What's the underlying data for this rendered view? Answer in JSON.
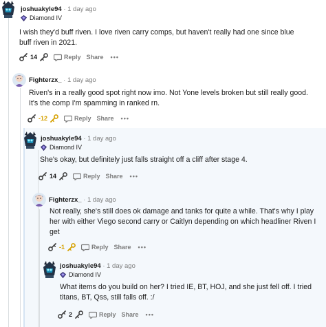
{
  "comments": [
    {
      "username": "joshuakyle94",
      "separator": "·",
      "time": "1 day ago",
      "flair": "Diamond IV",
      "body": "I wish they'd buff riven. I love riven carry comps, but haven't really had one since blue buff riven in 2021.",
      "votes": "14",
      "reply_label": "Reply",
      "share_label": "Share",
      "more_label": "•••"
    },
    {
      "username": "Fighterzx_",
      "separator": "·",
      "time": "1 day ago",
      "body": "Riven's in a really good spot right now imo. Not Yone levels broken but still really good. It's the comp I'm spamming in ranked rn.",
      "votes": "-12",
      "reply_label": "Reply",
      "share_label": "Share",
      "more_label": "•••"
    },
    {
      "username": "joshuakyle94",
      "separator": "·",
      "time": "1 day ago",
      "flair": "Diamond IV",
      "body": "She's okay, but definitely just falls straight off a cliff after stage 4.",
      "votes": "14",
      "reply_label": "Reply",
      "share_label": "Share",
      "more_label": "•••"
    },
    {
      "username": "Fighterzx_",
      "separator": "·",
      "time": "1 day ago",
      "body": "Not really, she's still does ok damage and tanks for quite a while. That's why I play her with either Viego second carry or Caitlyn depending on which headliner Riven I get",
      "votes": "-1",
      "reply_label": "Reply",
      "share_label": "Share",
      "more_label": "•••"
    },
    {
      "username": "joshuakyle94",
      "separator": "·",
      "time": "1 day ago",
      "flair": "Diamond IV",
      "body": "What items do you build on her? I tried IE, BT, HOJ, and she just fell off. I tried titans, BT, Qss, still falls off. :/",
      "votes": "2",
      "reply_label": "Reply",
      "share_label": "Share",
      "more_label": "•••"
    }
  ],
  "colors": {
    "downvote_active": "#d6a100",
    "meta_gray": "#7c7c7c",
    "highlight_bg": "#f4f8fc"
  },
  "icons": {
    "upvote": "key-upvote-icon",
    "downvote": "key-downvote-icon",
    "reply": "speech-bubble-icon",
    "flair": "diamond-rank-icon"
  }
}
